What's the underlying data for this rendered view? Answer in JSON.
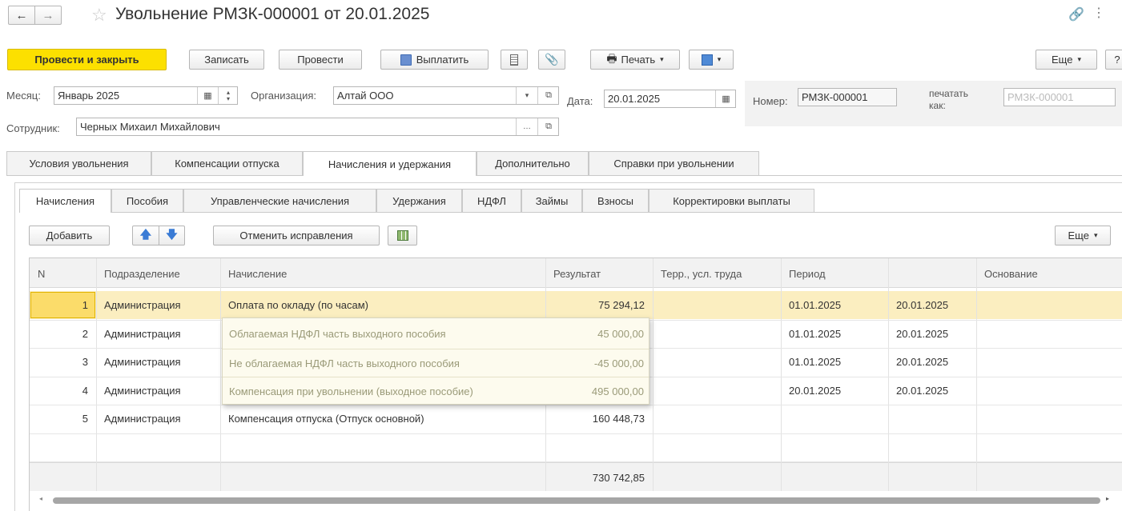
{
  "window": {
    "title": "Увольнение РМЗК-000001 от 20.01.2025"
  },
  "toolbar": {
    "post_close": "Провести и закрыть",
    "save": "Записать",
    "post": "Провести",
    "pay": "Выплатить",
    "print": "Печать",
    "more": "Еще",
    "help": "?"
  },
  "header": {
    "month_label": "Месяц:",
    "month_value": "Январь 2025",
    "org_label": "Организация:",
    "org_value": "Алтай ООО",
    "date_label": "Дата:",
    "date_value": "20.01.2025",
    "number_label": "Номер:",
    "number_value": "РМЗК-000001",
    "print_as_label_1": "печатать",
    "print_as_label_2": "как:",
    "print_as_placeholder": "РМЗК-000001",
    "employee_label": "Сотрудник:",
    "employee_value": "Черных Михаил Михайлович"
  },
  "tabs": [
    "Условия увольнения",
    "Компенсации отпуска",
    "Начисления и удержания",
    "Дополнительно",
    "Справки при увольнении"
  ],
  "subtabs": [
    "Начисления",
    "Пособия",
    "Управленческие начисления",
    "Удержания",
    "НДФЛ",
    "Займы",
    "Взносы",
    "Корректировки выплаты"
  ],
  "table_toolbar": {
    "add": "Добавить",
    "cancel_fix": "Отменить исправления",
    "more": "Еще"
  },
  "table": {
    "headers": [
      "N",
      "Подразделение",
      "Начисление",
      "Результат",
      "Терр., усл. труда",
      "Период",
      "",
      "Основание"
    ],
    "rows": [
      {
        "n": "1",
        "dept": "Администрация",
        "accrual": "Оплата по окладу (по часам)",
        "result": "75 294,12",
        "terr": "",
        "from": "01.01.2025",
        "to": "20.01.2025"
      },
      {
        "n": "2",
        "dept": "Администрация",
        "accrual": "",
        "result": "",
        "terr": "",
        "from": "01.01.2025",
        "to": "20.01.2025"
      },
      {
        "n": "3",
        "dept": "Администрация",
        "accrual": "",
        "result": "",
        "terr": "",
        "from": "01.01.2025",
        "to": "20.01.2025"
      },
      {
        "n": "4",
        "dept": "Администрация",
        "accrual": "",
        "result": "",
        "terr": "",
        "from": "20.01.2025",
        "to": "20.01.2025"
      },
      {
        "n": "5",
        "dept": "Администрация",
        "accrual": "Компенсация отпуска (Отпуск основной)",
        "result": "160 448,73",
        "terr": "",
        "from": "",
        "to": ""
      }
    ],
    "total": "730 742,85"
  },
  "tooltip": {
    "rows": [
      {
        "name": "Облагаемая НДФЛ часть выходного пособия",
        "value": "45 000,00"
      },
      {
        "name": "Не облагаемая НДФЛ часть выходного пособия",
        "value": "-45 000,00"
      },
      {
        "name": "Компенсация при увольнении (выходное пособие)",
        "value": "495 000,00"
      }
    ]
  }
}
